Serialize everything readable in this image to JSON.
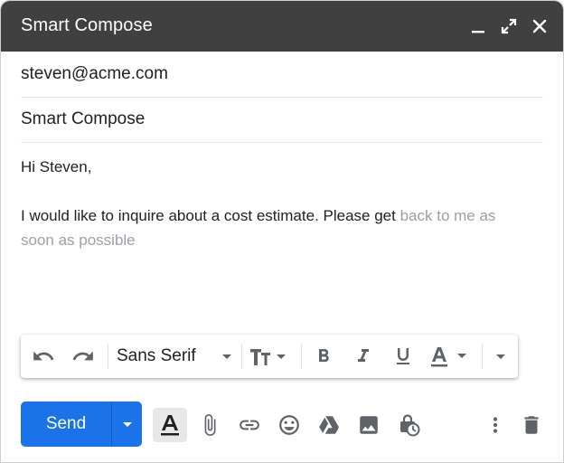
{
  "window": {
    "title": "Smart Compose",
    "controls": [
      "minimize-icon",
      "expand-icon",
      "close-icon"
    ]
  },
  "recipient": {
    "value": "steven@acme.com"
  },
  "subject": {
    "value": "Smart Compose"
  },
  "message": {
    "greeting": "Hi Steven,",
    "typed": "I would like to inquire about a cost estimate. Please get",
    "suggestion_line1": "back to me as",
    "suggestion_line2": "soon as possible"
  },
  "format_toolbar": {
    "font_name": "Sans Serif",
    "icons": [
      "undo-icon",
      "redo-icon",
      "font-dropdown-arrow-icon",
      "text-size-icon",
      "bold-icon",
      "italic-icon",
      "underline-icon",
      "text-color-icon",
      "more-formatting-icon"
    ]
  },
  "bottom_toolbar": {
    "send_label": "Send",
    "icons": [
      "formatting-toggle-icon",
      "attach-icon",
      "link-icon",
      "emoji-icon",
      "drive-icon",
      "photo-icon",
      "confidential-mode-icon",
      "more-options-icon",
      "trash-icon"
    ]
  },
  "colors": {
    "titlebar": "#404040",
    "accent": "#1a73e8",
    "suggestion_text": "#9aa0a6",
    "icon": "#5f6368"
  }
}
